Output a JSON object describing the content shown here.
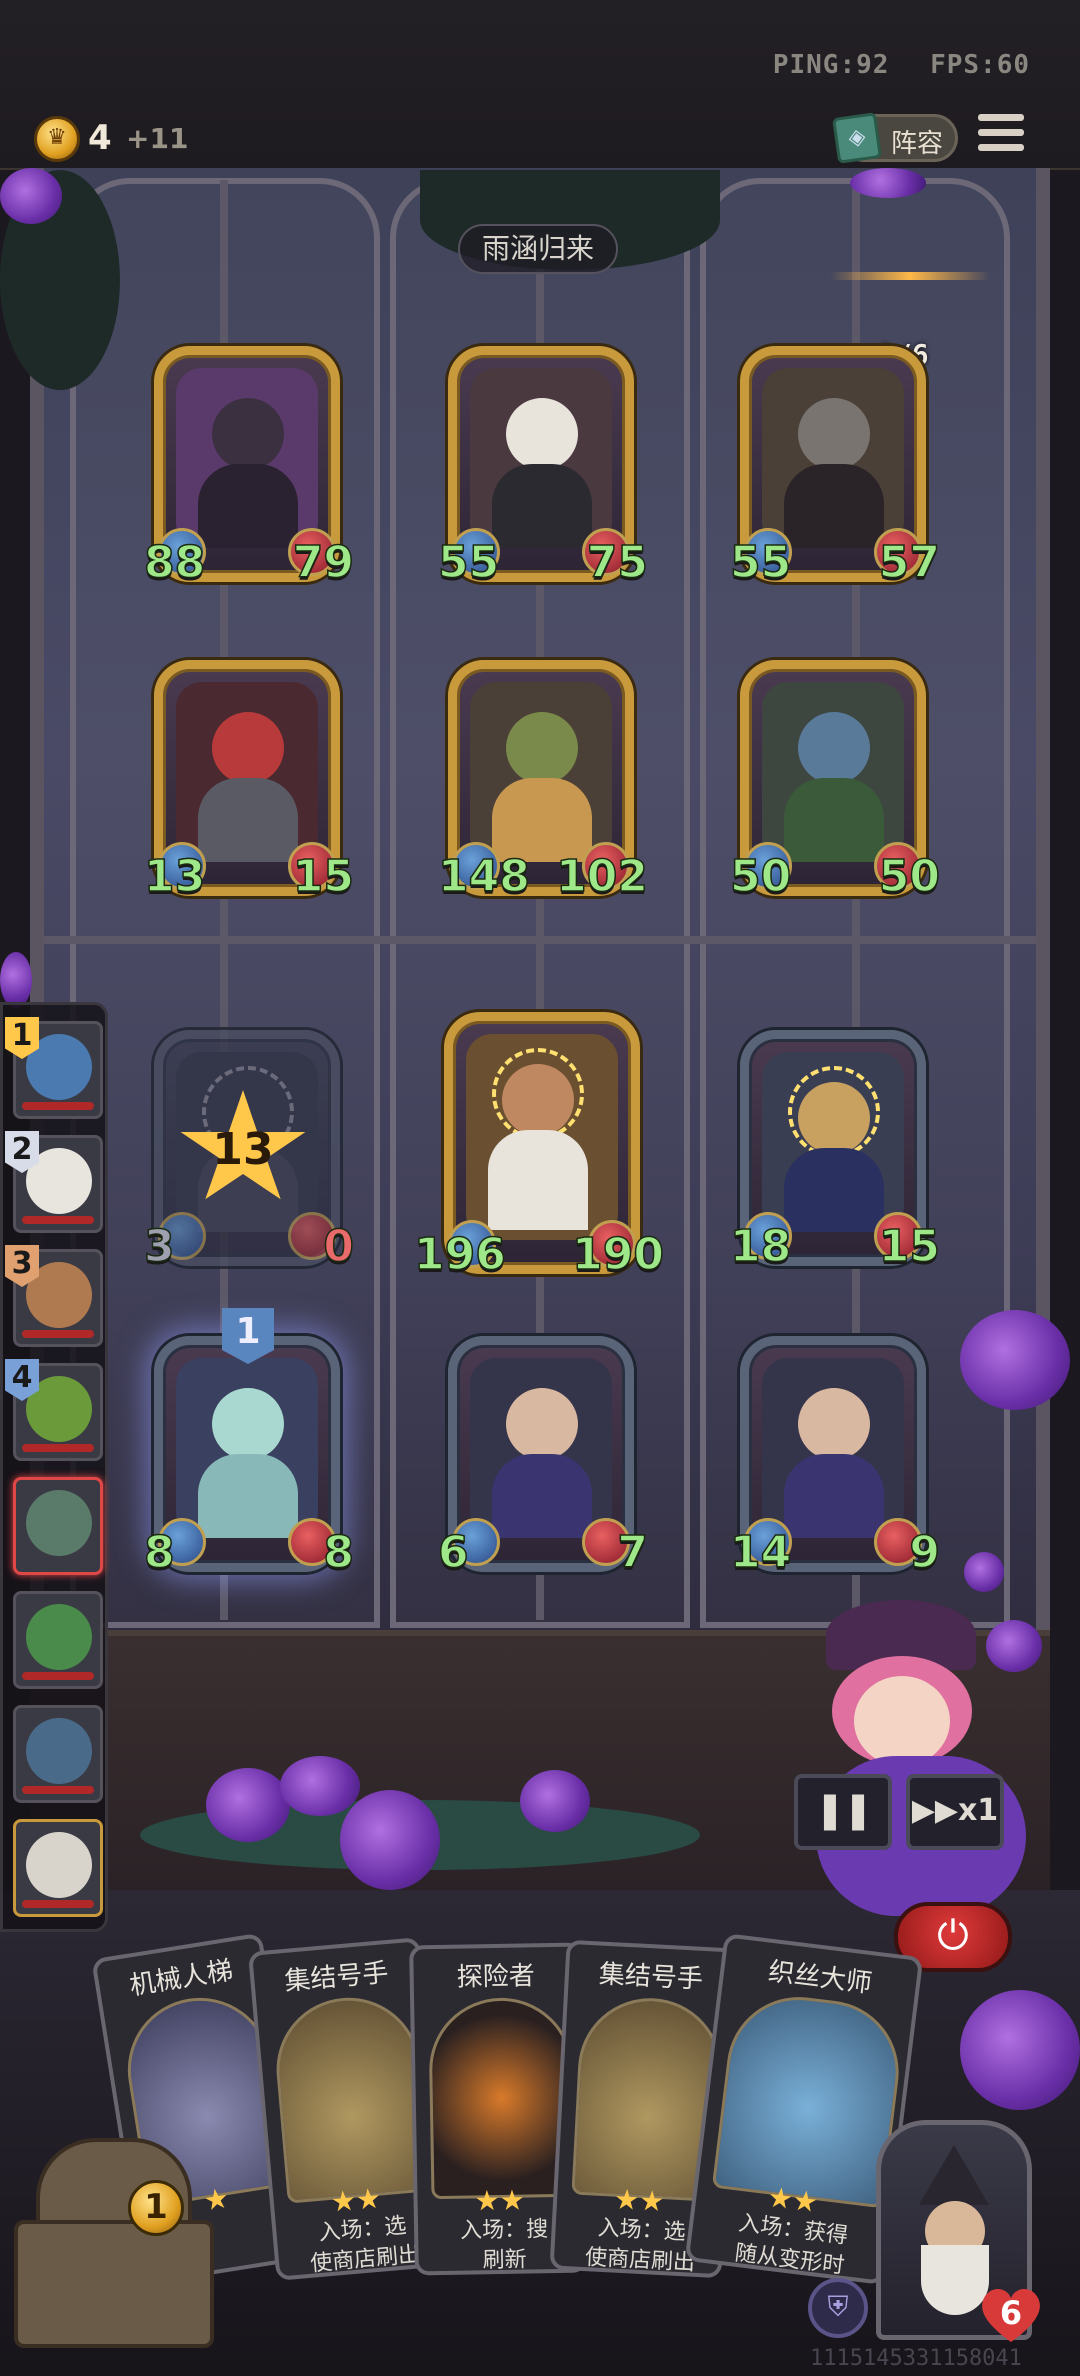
{
  "status": {
    "ping": "PING:92",
    "fps": "FPS:60"
  },
  "resources": {
    "gold": "4",
    "gold_income": "+11"
  },
  "top_buttons": {
    "lineup_label": "阵容"
  },
  "board": {
    "stage_name": "雨涵归来",
    "round_counter": "1/6",
    "enemy_units": [
      {
        "atk": "88",
        "hp": "79",
        "color": "#6a3a7a"
      },
      {
        "atk": "55",
        "hp": "75",
        "color": "#8a6a5a"
      },
      {
        "atk": "55",
        "hp": "57",
        "color": "#6a5a4a"
      },
      {
        "atk": "13",
        "hp": "15",
        "color": "#8a2a2a"
      },
      {
        "atk": "148",
        "hp": "102",
        "color": "#6a7a4a"
      },
      {
        "atk": "50",
        "hp": "50",
        "color": "#4a6a5a"
      }
    ],
    "player_units": [
      {
        "atk": "3",
        "hp": "0",
        "star_level": "13"
      },
      {
        "atk": "196",
        "hp": "190"
      },
      {
        "atk": "18",
        "hp": "15"
      },
      {
        "atk": "8",
        "hp": "8",
        "tier": "1"
      },
      {
        "atk": "6",
        "hp": "7"
      },
      {
        "atk": "14",
        "hp": "9"
      }
    ]
  },
  "roster": [
    {
      "rank": "1",
      "rank_color": "#ffc84a"
    },
    {
      "rank": "2",
      "rank_color": "#d8dce8"
    },
    {
      "rank": "3",
      "rank_color": "#e0a070"
    },
    {
      "rank": "4",
      "rank_color": "#7aa0d8"
    },
    {
      "rank": "",
      "rank_color": ""
    },
    {
      "rank": "",
      "rank_color": ""
    },
    {
      "rank": "",
      "rank_color": ""
    },
    {
      "rank": "",
      "rank_color": ""
    }
  ],
  "controls": {
    "pause_icon": "pause-icon",
    "speed_label": "▶▶x1",
    "power_icon": "power-icon"
  },
  "hand": [
    {
      "title": "机械人梯",
      "desc": ""
    },
    {
      "title": "集结号手",
      "desc": "入场：选\n使商店刷出"
    },
    {
      "title": "探险者",
      "desc": "入场：搜\n刷新"
    },
    {
      "title": "集结号手",
      "desc": "入场：选\n使商店刷出"
    },
    {
      "title": "织丝大师",
      "desc": "入场：获得\n随从变形时"
    }
  ],
  "shop": {
    "refresh_cost": "1"
  },
  "hero": {
    "health": "6"
  },
  "footer": {
    "uid": "1115145331158041"
  }
}
